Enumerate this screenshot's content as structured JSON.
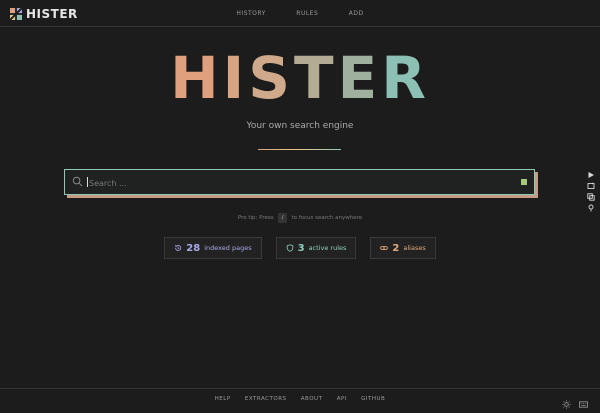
{
  "brand": {
    "name": "HISTER"
  },
  "nav": {
    "items": [
      "HISTORY",
      "RULES",
      "ADD"
    ]
  },
  "hero": {
    "letters": [
      "H",
      "I",
      "S",
      "T",
      "E",
      "R"
    ],
    "letter_colors": [
      "#e0a07d",
      "#d9a481",
      "#cfa98a",
      "#b4ab93",
      "#9fb19e",
      "#8cc0b4"
    ],
    "subtitle": "Your own search engine"
  },
  "search": {
    "placeholder": "Search ...",
    "accent": "#8dc9b4",
    "shadow": "#c79c86",
    "indicator": "#a7c97a"
  },
  "protip": {
    "prefix": "Pro tip: Press",
    "key": "/",
    "suffix": "to focus search anywhere"
  },
  "stats": [
    {
      "icon": "history-icon",
      "count": "28",
      "label": "indexed pages",
      "color": "#a9a9e8"
    },
    {
      "icon": "shield-icon",
      "count": "3",
      "label": "active rules",
      "color": "#8fd0c1"
    },
    {
      "icon": "link-icon",
      "count": "2",
      "label": "aliases",
      "color": "#e6a97a"
    }
  ],
  "side_icons": [
    "play-icon",
    "repeat-icon",
    "copy-icon",
    "pin-icon"
  ],
  "footer": {
    "links": [
      "HELP",
      "EXTRACTORS",
      "ABOUT",
      "API",
      "GITHUB"
    ],
    "icons": [
      "sun-icon",
      "keyboard-icon"
    ]
  }
}
